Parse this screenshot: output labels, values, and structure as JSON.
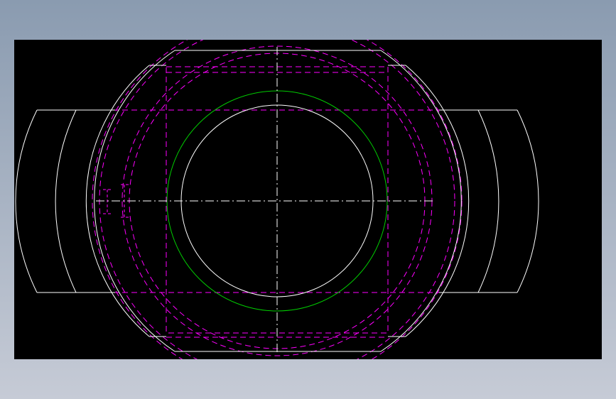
{
  "background": {
    "gradient_top": "#8a9bb0",
    "gradient_bottom": "#c6cbd6"
  },
  "viewport": {
    "background_color": "#000000"
  },
  "line_colors": {
    "outline": "#ffffff",
    "hidden": "#ff00ff",
    "bore_circle": "#00cc00",
    "centerline": "#ffffff"
  },
  "line_styles": {
    "hidden": "dashed",
    "centerline": "dash-dot"
  }
}
